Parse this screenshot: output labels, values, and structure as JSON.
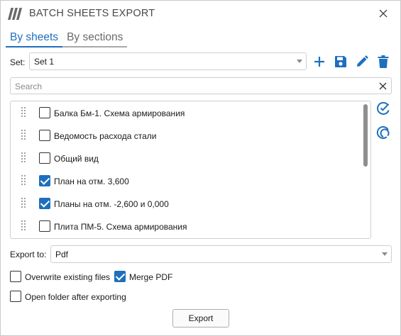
{
  "window": {
    "title": "BATCH SHEETS EXPORT",
    "logo_icon": "app-logo-icon",
    "close_icon": "close-icon",
    "accent_color": "#1e6fbd"
  },
  "tabs": [
    {
      "label": "By sheets",
      "active": true
    },
    {
      "label": "By sections",
      "active": false
    }
  ],
  "set": {
    "label": "Set:",
    "selected": "Set 1",
    "actions": [
      {
        "name": "add-set-button",
        "icon": "plus-icon"
      },
      {
        "name": "save-set-button",
        "icon": "save-icon"
      },
      {
        "name": "rename-set-button",
        "icon": "pencil-icon"
      },
      {
        "name": "delete-set-button",
        "icon": "trash-icon"
      }
    ]
  },
  "search": {
    "placeholder": "Search",
    "value": ""
  },
  "sheets": [
    {
      "label": "Балка Бм-1. Схема армирования",
      "checked": false
    },
    {
      "label": "Ведомость расхода стали",
      "checked": false
    },
    {
      "label": "Общий вид",
      "checked": false
    },
    {
      "label": "План на отм. 3,600",
      "checked": true
    },
    {
      "label": "Планы на отм. -2,600 и 0,000",
      "checked": true
    },
    {
      "label": "Плита ПМ-5. Схема армирования",
      "checked": false
    }
  ],
  "side_actions": [
    {
      "name": "check-all-button",
      "icon": "check-all-icon"
    },
    {
      "name": "uncheck-all-button",
      "icon": "uncheck-all-icon"
    }
  ],
  "export_to": {
    "label": "Export to:",
    "selected": "Pdf"
  },
  "options": {
    "overwrite": {
      "label": "Overwrite existing files",
      "checked": false
    },
    "merge_pdf": {
      "label": "Merge PDF",
      "checked": true
    },
    "open_folder": {
      "label": "Open folder after exporting",
      "checked": false
    }
  },
  "export_button": {
    "label": "Export"
  }
}
